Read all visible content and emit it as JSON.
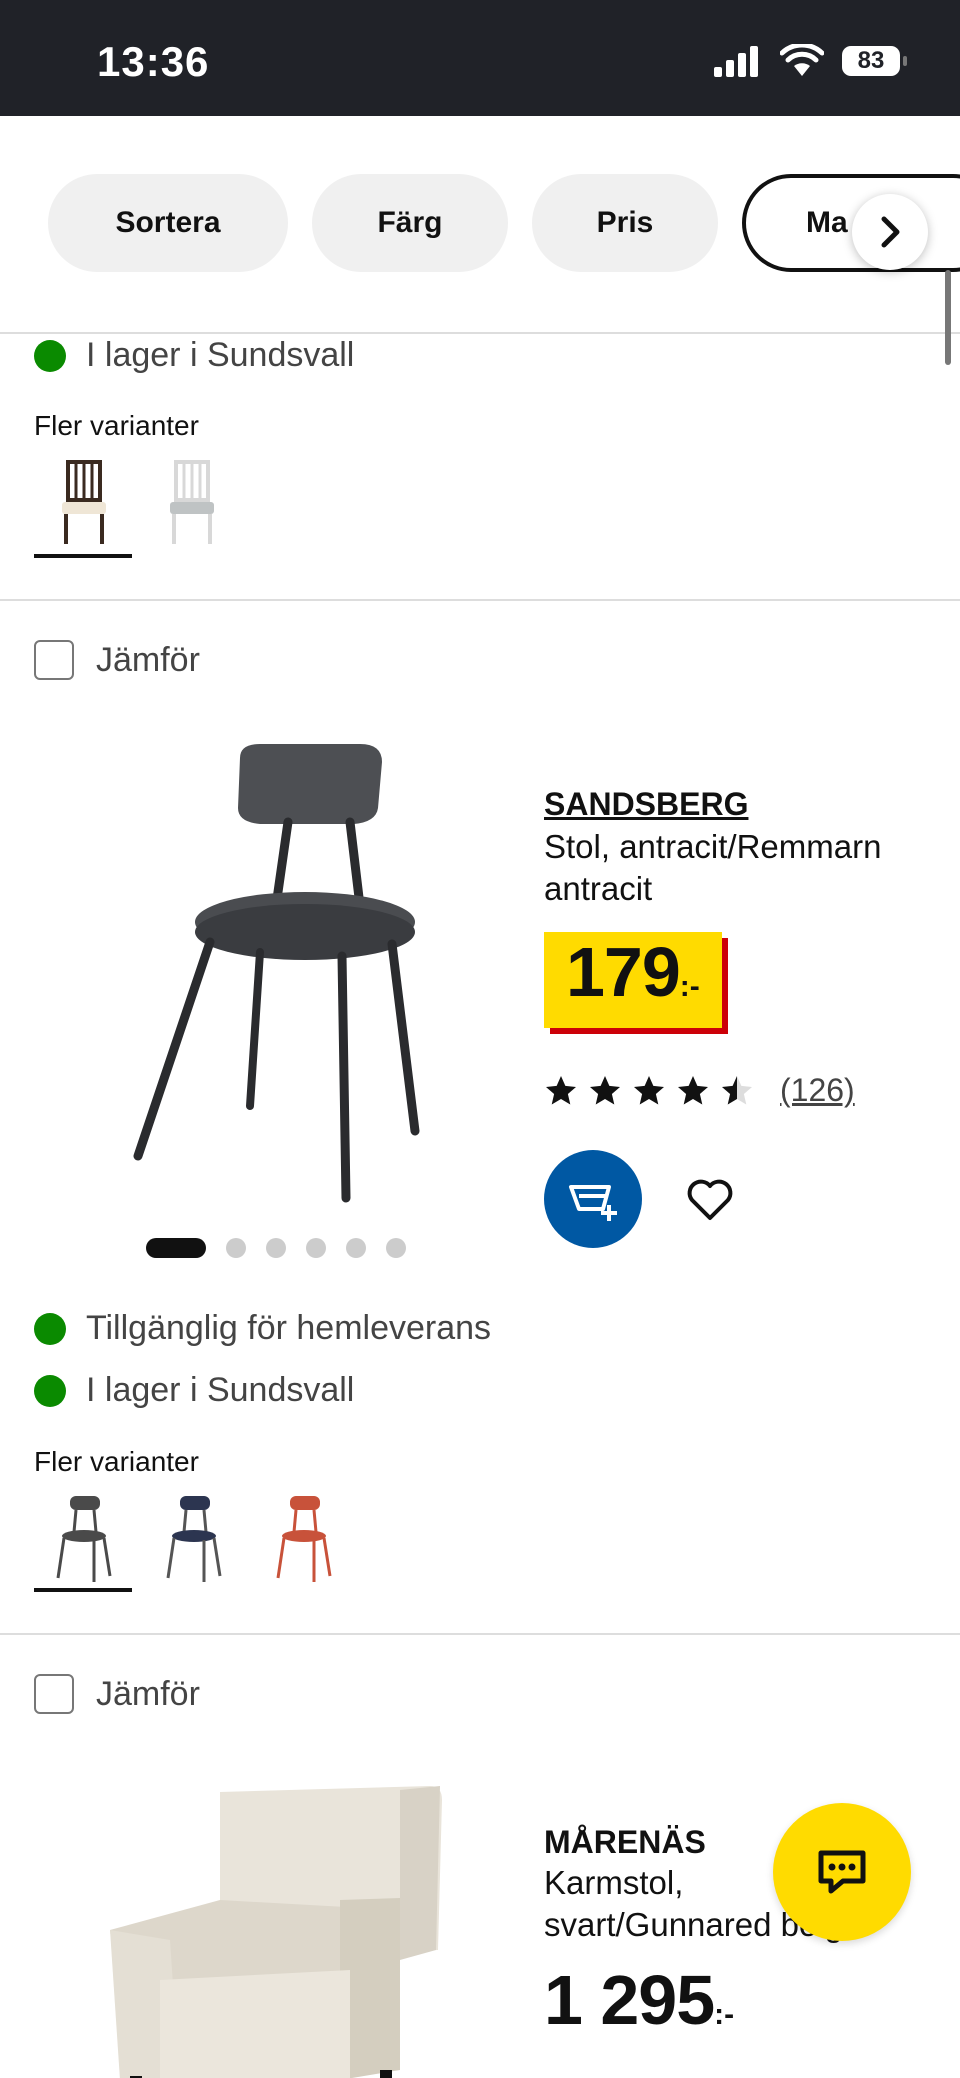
{
  "status_bar": {
    "time": "13:36",
    "battery": "83"
  },
  "filters": [
    {
      "label": "Sortera"
    },
    {
      "label": "Färg"
    },
    {
      "label": "Pris"
    },
    {
      "label": "Ma"
    }
  ],
  "section_top": {
    "stock": "I lager i Sundsvall",
    "variants_label": "Fler varianter",
    "variant_colors": [
      "#3a2a20",
      "#e8e8e8"
    ]
  },
  "products": [
    {
      "compare_label": "Jämför",
      "name": "SANDSBERG",
      "description_line1": "Stol, antracit/Remmarn",
      "description_line2": "antracit",
      "price": "179",
      "price_suffix": ":-",
      "rating": 4.5,
      "reviews": "(126)",
      "availability_home": "Tillgänglig för hemleverans",
      "availability_store": "I lager i Sundsvall",
      "variants_label": "Fler varianter",
      "variant_colors": [
        "#4a4a4a",
        "#2c3550",
        "#c8523a"
      ],
      "image_count": 6,
      "active_image": 0
    },
    {
      "compare_label": "Jämför",
      "name": "MÅRENÄS",
      "description_line1": "Karmstol,",
      "description_line2": "svart/Gunnared beige",
      "price": "1 295",
      "price_suffix": ":-"
    }
  ],
  "colors": {
    "accent_yellow": "#ffdb00",
    "ikea_blue": "#0058a3",
    "stock_green": "#0a8a00",
    "price_red": "#cc0008"
  }
}
